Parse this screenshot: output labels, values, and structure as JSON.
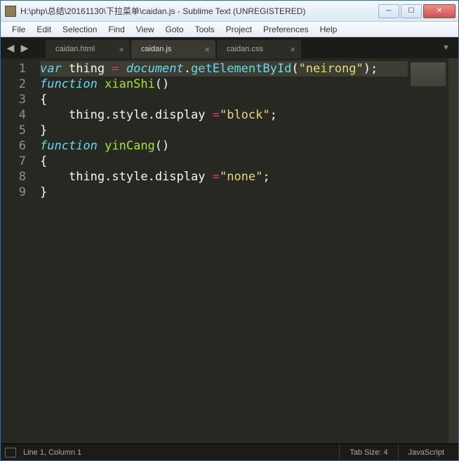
{
  "window": {
    "title": "H:\\php\\总结\\20161130\\下拉菜单\\caidan.js - Sublime Text (UNREGISTERED)"
  },
  "menu": {
    "file": "File",
    "edit": "Edit",
    "selection": "Selection",
    "find": "Find",
    "view": "View",
    "goto": "Goto",
    "tools": "Tools",
    "project": "Project",
    "preferences": "Preferences",
    "help": "Help"
  },
  "tabs": [
    {
      "label": "caidan.html",
      "active": false
    },
    {
      "label": "caidan.js",
      "active": true
    },
    {
      "label": "caidan.css",
      "active": false
    }
  ],
  "gutter": [
    "1",
    "2",
    "3",
    "4",
    "5",
    "6",
    "7",
    "8",
    "9"
  ],
  "code": {
    "l1": {
      "kw": "var",
      "v": " thing ",
      "op": "=",
      "sp": " ",
      "obj": "document",
      "dot": ".",
      "fn": "getElementById",
      "lp": "(",
      "str": "\"neirong\"",
      "rp": ")",
      "semi": ";"
    },
    "l2": {
      "kw": "function",
      "sp": " ",
      "name": "xianShi",
      "lp": "(",
      "rp": ")"
    },
    "l3": {
      "brace": "{"
    },
    "l4": {
      "ind": "    ",
      "v": "thing",
      "d1": ".",
      "p1": "style",
      "d2": ".",
      "p2": "display ",
      "op": "=",
      "str": "\"block\"",
      "semi": ";"
    },
    "l5": {
      "brace": "}"
    },
    "l6": {
      "kw": "function",
      "sp": " ",
      "name": "yinCang",
      "lp": "(",
      "rp": ")"
    },
    "l7": {
      "brace": "{"
    },
    "l8": {
      "ind": "    ",
      "v": "thing",
      "d1": ".",
      "p1": "style",
      "d2": ".",
      "p2": "display ",
      "op": "=",
      "str": "\"none\"",
      "semi": ";"
    },
    "l9": {
      "brace": "}"
    }
  },
  "status": {
    "pos": "Line 1, Column 1",
    "tabsize": "Tab Size: 4",
    "syntax": "JavaScript"
  }
}
